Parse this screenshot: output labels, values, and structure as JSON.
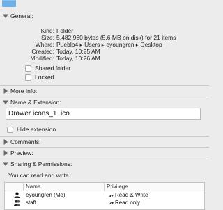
{
  "sections": {
    "general": "General:",
    "more_info": "More Info:",
    "name_ext": "Name & Extension:",
    "comments": "Comments:",
    "preview": "Preview:",
    "sharing": "Sharing & Permissions:"
  },
  "general": {
    "rows": [
      {
        "key": "Kind:",
        "value": "Folder"
      },
      {
        "key": "Size:",
        "value": "5,482,960 bytes (5.6 MB on disk) for 21 items"
      },
      {
        "key": "Where:",
        "value": "Pueblo4 ▸ Users ▸ eyoungren ▸ Desktop"
      },
      {
        "key": "Created:",
        "value": "Today, 10:25 AM"
      },
      {
        "key": "Modified:",
        "value": "Today, 10:26 AM"
      }
    ],
    "shared_folder": "Shared folder",
    "locked": "Locked"
  },
  "name_ext": {
    "filename": "Drawer icons_1 .ico",
    "hide_extension": "Hide extension"
  },
  "sharing": {
    "summary": "You can read and write",
    "col_name": "Name",
    "col_privilege": "Privilege",
    "rows": [
      {
        "name": "eyoungren (Me)",
        "privilege": "Read & Write"
      },
      {
        "name": "staff",
        "privilege": "Read only"
      }
    ]
  }
}
